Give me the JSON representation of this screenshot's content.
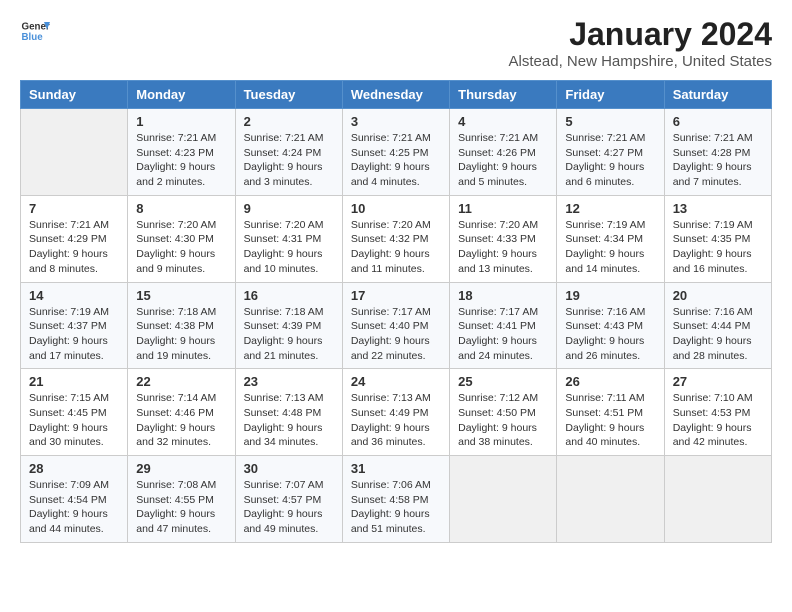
{
  "header": {
    "logo_line1": "General",
    "logo_line2": "Blue",
    "title": "January 2024",
    "subtitle": "Alstead, New Hampshire, United States"
  },
  "days_of_week": [
    "Sunday",
    "Monday",
    "Tuesday",
    "Wednesday",
    "Thursday",
    "Friday",
    "Saturday"
  ],
  "weeks": [
    [
      {
        "num": "",
        "content": ""
      },
      {
        "num": "1",
        "content": "Sunrise: 7:21 AM\nSunset: 4:23 PM\nDaylight: 9 hours\nand 2 minutes."
      },
      {
        "num": "2",
        "content": "Sunrise: 7:21 AM\nSunset: 4:24 PM\nDaylight: 9 hours\nand 3 minutes."
      },
      {
        "num": "3",
        "content": "Sunrise: 7:21 AM\nSunset: 4:25 PM\nDaylight: 9 hours\nand 4 minutes."
      },
      {
        "num": "4",
        "content": "Sunrise: 7:21 AM\nSunset: 4:26 PM\nDaylight: 9 hours\nand 5 minutes."
      },
      {
        "num": "5",
        "content": "Sunrise: 7:21 AM\nSunset: 4:27 PM\nDaylight: 9 hours\nand 6 minutes."
      },
      {
        "num": "6",
        "content": "Sunrise: 7:21 AM\nSunset: 4:28 PM\nDaylight: 9 hours\nand 7 minutes."
      }
    ],
    [
      {
        "num": "7",
        "content": "Sunrise: 7:21 AM\nSunset: 4:29 PM\nDaylight: 9 hours\nand 8 minutes."
      },
      {
        "num": "8",
        "content": "Sunrise: 7:20 AM\nSunset: 4:30 PM\nDaylight: 9 hours\nand 9 minutes."
      },
      {
        "num": "9",
        "content": "Sunrise: 7:20 AM\nSunset: 4:31 PM\nDaylight: 9 hours\nand 10 minutes."
      },
      {
        "num": "10",
        "content": "Sunrise: 7:20 AM\nSunset: 4:32 PM\nDaylight: 9 hours\nand 11 minutes."
      },
      {
        "num": "11",
        "content": "Sunrise: 7:20 AM\nSunset: 4:33 PM\nDaylight: 9 hours\nand 13 minutes."
      },
      {
        "num": "12",
        "content": "Sunrise: 7:19 AM\nSunset: 4:34 PM\nDaylight: 9 hours\nand 14 minutes."
      },
      {
        "num": "13",
        "content": "Sunrise: 7:19 AM\nSunset: 4:35 PM\nDaylight: 9 hours\nand 16 minutes."
      }
    ],
    [
      {
        "num": "14",
        "content": "Sunrise: 7:19 AM\nSunset: 4:37 PM\nDaylight: 9 hours\nand 17 minutes."
      },
      {
        "num": "15",
        "content": "Sunrise: 7:18 AM\nSunset: 4:38 PM\nDaylight: 9 hours\nand 19 minutes."
      },
      {
        "num": "16",
        "content": "Sunrise: 7:18 AM\nSunset: 4:39 PM\nDaylight: 9 hours\nand 21 minutes."
      },
      {
        "num": "17",
        "content": "Sunrise: 7:17 AM\nSunset: 4:40 PM\nDaylight: 9 hours\nand 22 minutes."
      },
      {
        "num": "18",
        "content": "Sunrise: 7:17 AM\nSunset: 4:41 PM\nDaylight: 9 hours\nand 24 minutes."
      },
      {
        "num": "19",
        "content": "Sunrise: 7:16 AM\nSunset: 4:43 PM\nDaylight: 9 hours\nand 26 minutes."
      },
      {
        "num": "20",
        "content": "Sunrise: 7:16 AM\nSunset: 4:44 PM\nDaylight: 9 hours\nand 28 minutes."
      }
    ],
    [
      {
        "num": "21",
        "content": "Sunrise: 7:15 AM\nSunset: 4:45 PM\nDaylight: 9 hours\nand 30 minutes."
      },
      {
        "num": "22",
        "content": "Sunrise: 7:14 AM\nSunset: 4:46 PM\nDaylight: 9 hours\nand 32 minutes."
      },
      {
        "num": "23",
        "content": "Sunrise: 7:13 AM\nSunset: 4:48 PM\nDaylight: 9 hours\nand 34 minutes."
      },
      {
        "num": "24",
        "content": "Sunrise: 7:13 AM\nSunset: 4:49 PM\nDaylight: 9 hours\nand 36 minutes."
      },
      {
        "num": "25",
        "content": "Sunrise: 7:12 AM\nSunset: 4:50 PM\nDaylight: 9 hours\nand 38 minutes."
      },
      {
        "num": "26",
        "content": "Sunrise: 7:11 AM\nSunset: 4:51 PM\nDaylight: 9 hours\nand 40 minutes."
      },
      {
        "num": "27",
        "content": "Sunrise: 7:10 AM\nSunset: 4:53 PM\nDaylight: 9 hours\nand 42 minutes."
      }
    ],
    [
      {
        "num": "28",
        "content": "Sunrise: 7:09 AM\nSunset: 4:54 PM\nDaylight: 9 hours\nand 44 minutes."
      },
      {
        "num": "29",
        "content": "Sunrise: 7:08 AM\nSunset: 4:55 PM\nDaylight: 9 hours\nand 47 minutes."
      },
      {
        "num": "30",
        "content": "Sunrise: 7:07 AM\nSunset: 4:57 PM\nDaylight: 9 hours\nand 49 minutes."
      },
      {
        "num": "31",
        "content": "Sunrise: 7:06 AM\nSunset: 4:58 PM\nDaylight: 9 hours\nand 51 minutes."
      },
      {
        "num": "",
        "content": ""
      },
      {
        "num": "",
        "content": ""
      },
      {
        "num": "",
        "content": ""
      }
    ]
  ]
}
